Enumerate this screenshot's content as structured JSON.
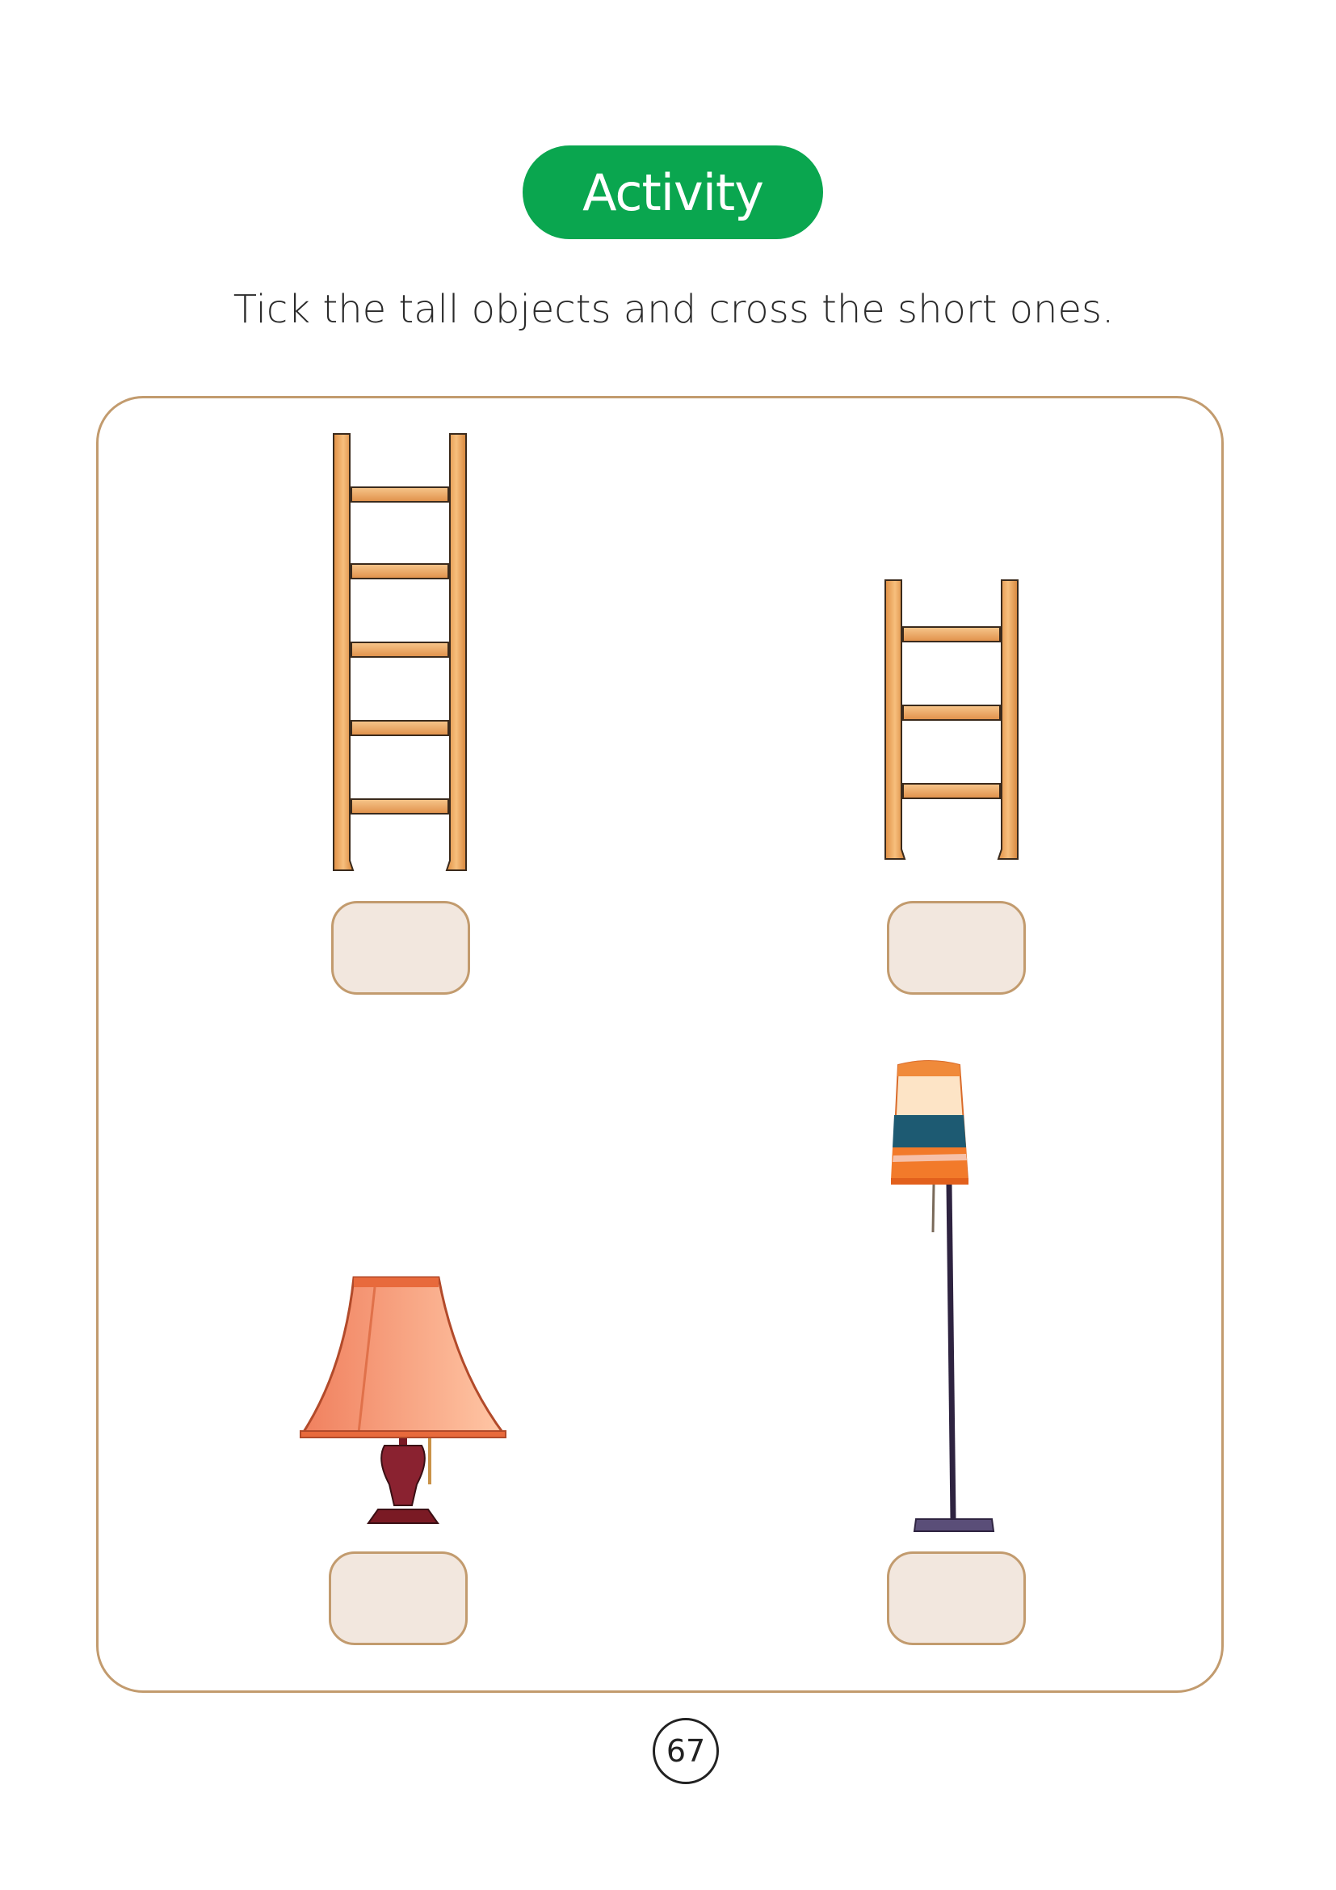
{
  "header": {
    "badge_label": "Activity"
  },
  "instruction": "Tick the tall objects and cross the short ones.",
  "items": [
    {
      "name": "tall ladder",
      "answer": ""
    },
    {
      "name": "short ladder",
      "answer": ""
    },
    {
      "name": "table lamp",
      "answer": ""
    },
    {
      "name": "floor lamp",
      "answer": ""
    }
  ],
  "footer": {
    "page_number": "67"
  },
  "colors": {
    "accent_green": "#0aa64f",
    "border_brown": "#c29b6e",
    "box_fill": "#f2e7de",
    "ladder_wood": "#f0a55b"
  }
}
